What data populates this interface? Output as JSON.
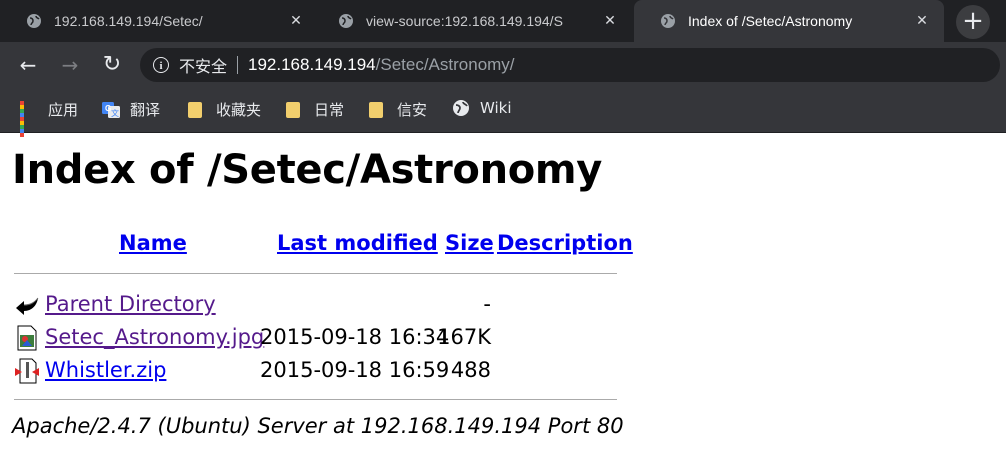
{
  "tabs": [
    {
      "title": "192.168.149.194/Setec/",
      "close": "✕"
    },
    {
      "title": "view-source:192.168.149.194/S",
      "close": "✕"
    },
    {
      "title": "Index of /Setec/Astronomy",
      "close": "✕"
    }
  ],
  "newtab_label": "+",
  "toolbar": {
    "back": "←",
    "forward": "→",
    "reload": "↻"
  },
  "omnibox": {
    "security_icon": "i",
    "security_text": "不安全",
    "host": "192.168.149.194",
    "path": "/Setec/Astronomy/"
  },
  "bookmarks": [
    {
      "label": "应用",
      "icon": "apps-grid-icon"
    },
    {
      "label": "翻译",
      "icon": "google-translate-icon"
    },
    {
      "label": "收藏夹",
      "icon": "folder-icon"
    },
    {
      "label": "日常",
      "icon": "folder-icon"
    },
    {
      "label": "信安",
      "icon": "folder-icon"
    },
    {
      "label": "Wiki",
      "icon": "globe-icon"
    }
  ],
  "page": {
    "title": "Index of /Setec/Astronomy",
    "columns": {
      "name": "Name",
      "modified": "Last modified",
      "size": "Size",
      "description": "Description"
    },
    "rows": [
      {
        "name": "Parent Directory",
        "modified": "",
        "size": "-",
        "icon": "back-arrow-icon"
      },
      {
        "name": "Setec_Astronomy.jpg",
        "modified": "2015-09-18 16:34",
        "size": "167K",
        "icon": "image-file-icon"
      },
      {
        "name": "Whistler.zip",
        "modified": "2015-09-18 16:59",
        "size": "488",
        "icon": "compressed-file-icon"
      }
    ],
    "footer": "Apache/2.4.7 (Ubuntu) Server at 192.168.149.194 Port 80"
  },
  "colors": {
    "chrome_dark": "#202124",
    "chrome_toolbar": "#35363a",
    "link": "#0000ee",
    "visited": "#551a8b"
  }
}
